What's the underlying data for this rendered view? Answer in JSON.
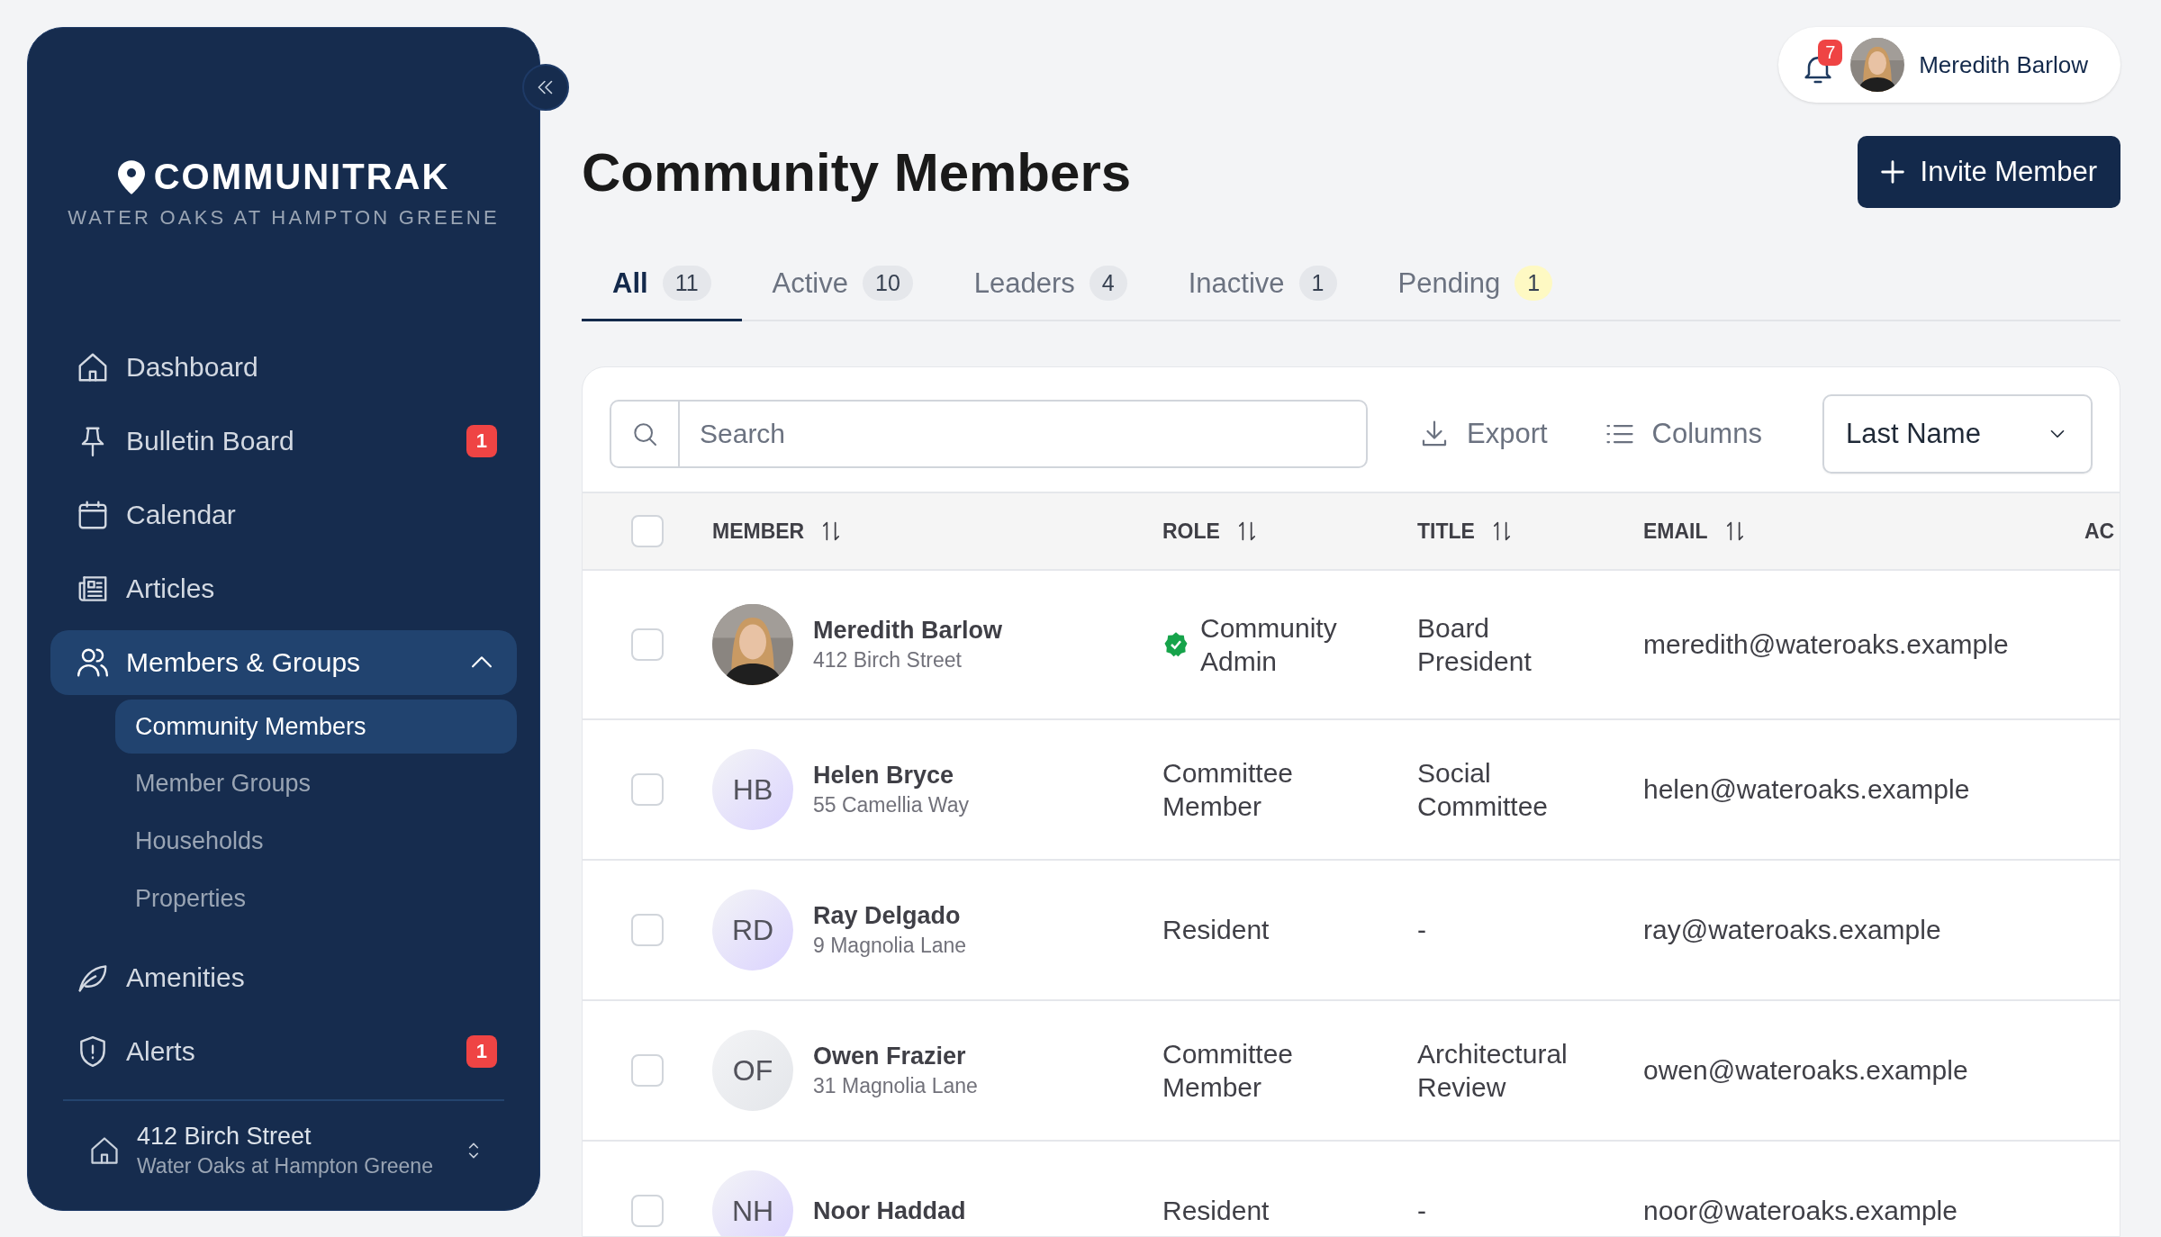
{
  "sidebar": {
    "logo": "COMMUNITRAK",
    "subtitle": "WATER OAKS AT HAMPTON GREENE",
    "items": [
      {
        "label": "Dashboard",
        "selected": false
      },
      {
        "label": "Bulletin Board",
        "selected": false,
        "badge": "1"
      },
      {
        "label": "Calendar",
        "selected": false
      },
      {
        "label": "Articles",
        "selected": false
      },
      {
        "label": "Members & Groups",
        "selected": true,
        "expanded": true,
        "children": [
          {
            "label": "Community Members",
            "selected": true
          },
          {
            "label": "Member Groups",
            "selected": false
          },
          {
            "label": "Households",
            "selected": false
          },
          {
            "label": "Properties",
            "selected": false
          }
        ]
      },
      {
        "label": "Amenities",
        "selected": false
      },
      {
        "label": "Alerts",
        "selected": false,
        "badge": "1"
      }
    ],
    "footer": {
      "address": "412 Birch Street",
      "community": "Water Oaks at Hampton Greene"
    }
  },
  "header": {
    "notifications": "7",
    "user": "Meredith Barlow"
  },
  "page_title": "Community Members",
  "invite_button": "Invite Member",
  "tabs": [
    {
      "label": "All",
      "count": "11",
      "selected": true,
      "color": "#e5e7eb"
    },
    {
      "label": "Active",
      "count": "10",
      "selected": false,
      "color": "#e5e7eb"
    },
    {
      "label": "Leaders",
      "count": "4",
      "selected": false,
      "color": "#e5e7eb"
    },
    {
      "label": "Inactive",
      "count": "1",
      "selected": false,
      "color": "#e5e7eb"
    },
    {
      "label": "Pending",
      "count": "1",
      "selected": false,
      "color": "#fef9c3"
    }
  ],
  "toolbar": {
    "search": {
      "placeholder": "Search"
    },
    "export": "Export",
    "columns": "Columns",
    "sort": "Last Name"
  },
  "table": {
    "select_all": {
      "checked": false
    },
    "columns": [
      "MEMBER",
      "ROLE",
      "TITLE",
      "EMAIL",
      "AC"
    ],
    "rows": [
      {
        "checked": false,
        "name": "Meredith Barlow",
        "address": "412 Birch Street",
        "verified": true,
        "role": "Community Admin",
        "title": "Board President",
        "email": "meredith@wateroaks.example"
      },
      {
        "checked": false,
        "avatar": {
          "kind": "initials",
          "initials": "HB",
          "color": "#ddd6fe"
        },
        "name": "Helen Bryce",
        "address": "55 Camellia Way",
        "verified": false,
        "role": "Committee Member",
        "title": "Social Committee",
        "email": "helen@wateroaks.example"
      },
      {
        "checked": false,
        "avatar": {
          "kind": "initials",
          "initials": "RD",
          "color": "#ddd6fe"
        },
        "name": "Ray Delgado",
        "address": "9 Magnolia Lane",
        "verified": false,
        "role": "Resident",
        "title": "-",
        "email": "ray@wateroaks.example"
      },
      {
        "checked": false,
        "avatar": {
          "kind": "initials",
          "initials": "OF",
          "color": "#e5e7eb"
        },
        "name": "Owen Frazier",
        "address": "31 Magnolia Lane",
        "verified": false,
        "role": "Committee Member",
        "title": "Architectural Review",
        "email": "owen@wateroaks.example"
      },
      {
        "checked": false,
        "avatar": {
          "kind": "initials",
          "initials": "NH",
          "color": "#ddd6fe"
        },
        "name": "Noor Haddad",
        "verified": false,
        "role": "Resident",
        "title": "-",
        "email": "noor@wateroaks.example"
      }
    ]
  }
}
